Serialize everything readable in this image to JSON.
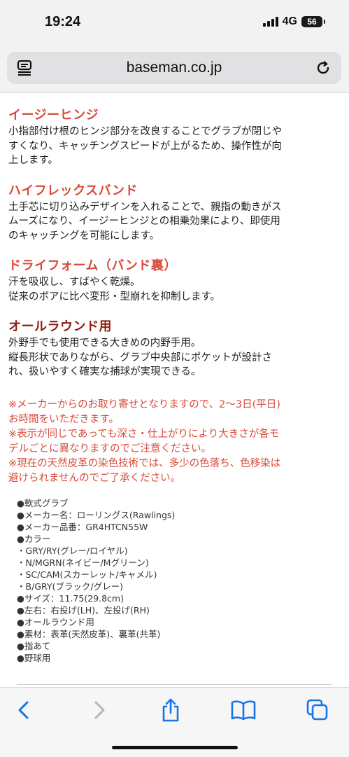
{
  "status_bar": {
    "time": "19:24",
    "network": "4G",
    "battery": "56"
  },
  "browser": {
    "url": "baseman.co.jp"
  },
  "features": [
    {
      "title": "イージーヒンジ",
      "desc": [
        "小指部付け根のヒンジ部分を改良することでグラブが閉じや",
        "すくなり、キャッチングスピードが上がるため、操作性が向",
        "上します。"
      ]
    },
    {
      "title": "ハイフレックスバンド",
      "desc": [
        "土手芯に切り込みデザインを入れることで、親指の動きがス",
        "ムーズになり、イージーヒンジとの相乗効果により、即使用",
        "のキャッチングを可能にします。"
      ]
    },
    {
      "title": "ドライフォーム（バンド裏）",
      "desc": [
        "汗を吸収し、すばやく乾燥。",
        "従来のボアに比べ変形・型崩れを抑制します。"
      ]
    },
    {
      "title": "オールラウンド用",
      "desc": [
        "外野手でも使用できる大きめの内野手用。",
        "縦長形状でありながら、グラブ中央部にポケットが設計さ",
        "れ、扱いやすく確実な捕球が実現できる。"
      ]
    }
  ],
  "notices": [
    "※メーカーからのお取り寄せとなりますので、2〜3日(平日)",
    "お時間をいただきます。",
    "※表示が同じであっても深さ・仕上がりにより大きさが各モ",
    "デルごとに異なりますのでご注意ください。",
    "※現在の天然皮革の染色技術では、多少の色落ち、色移染は",
    "避けられませんのでご了承ください。"
  ],
  "specs": [
    "●軟式グラブ",
    "●メーカー名：ローリングス(Rawlings)",
    "●メーカー品番：GR4HTCN55W",
    "●カラー",
    "・GRY/RY(グレー/ロイヤル)",
    "・N/MGRN(ネイビー/Mグリーン)",
    "・SC/CAM(スカーレット/キャメル)",
    "・B/GRY(ブラック/グレー)",
    "●サイズ：11.75(29.8cm)",
    "●左右：右投げ(LH)、左投げ(RH)",
    "●オールラウンド用",
    "●素材：表革(天然皮革)、裏革(共革)",
    "●指あて",
    "●野球用"
  ],
  "colors": {
    "accent_red": "#d94a3a",
    "dark_red": "#8a1f12",
    "ios_blue": "#1a73e8"
  },
  "toolbar": {
    "back": "chevron-left-icon",
    "forward": "chevron-right-icon",
    "share": "share-icon",
    "bookmarks": "book-icon",
    "tabs": "tabs-icon"
  }
}
